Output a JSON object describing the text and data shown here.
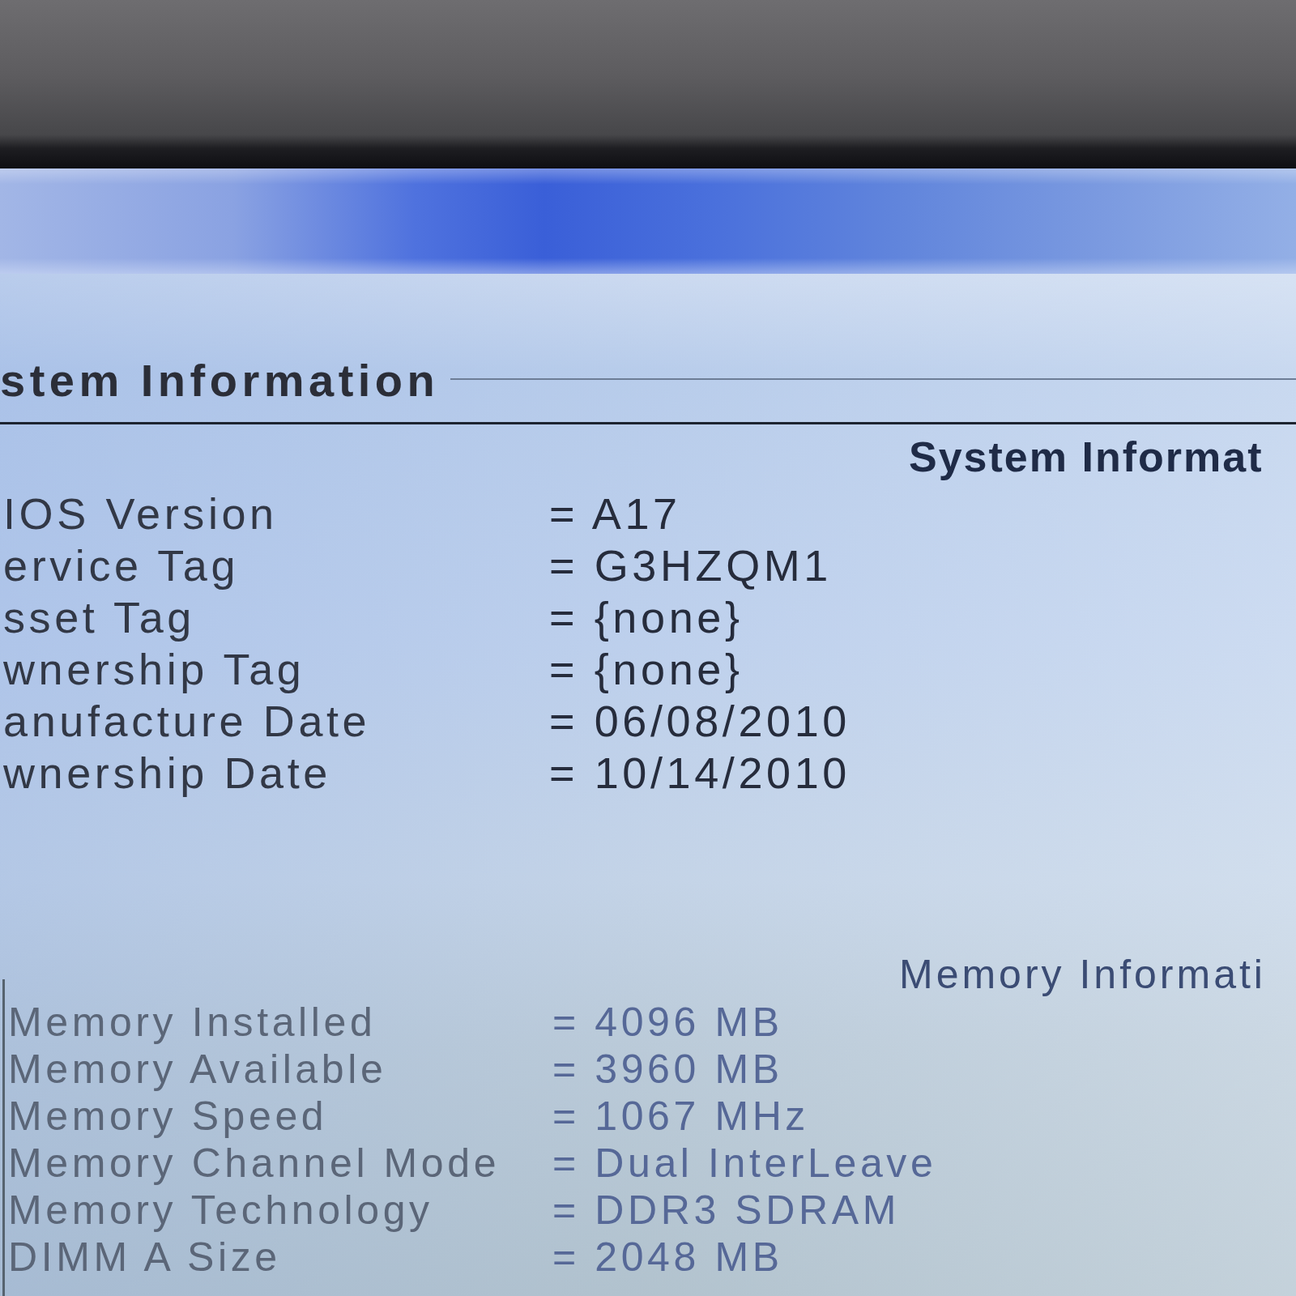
{
  "section": {
    "title": "stem Information"
  },
  "system_info": {
    "title": "System Informat",
    "rows": [
      {
        "label": "IOS Version",
        "value": "= A17"
      },
      {
        "label": "ervice Tag",
        "value": "= G3HZQM1"
      },
      {
        "label": "sset Tag",
        "value": "= {none}"
      },
      {
        "label": "wnership Tag",
        "value": "= {none}"
      },
      {
        "label": "anufacture Date",
        "value": "= 06/08/2010"
      },
      {
        "label": "wnership Date",
        "value": "= 10/14/2010"
      }
    ]
  },
  "memory_info": {
    "title": "Memory Informati",
    "rows": [
      {
        "label": "Memory Installed",
        "value": "= 4096 MB"
      },
      {
        "label": "Memory Available",
        "value": "= 3960 MB"
      },
      {
        "label": "Memory Speed",
        "value": "= 1067 MHz"
      },
      {
        "label": "Memory Channel Mode",
        "value": "= Dual InterLeave"
      },
      {
        "label": "Memory Technology",
        "value": "= DDR3 SDRAM"
      },
      {
        "label": "DIMM A Size",
        "value": "= 2048 MB"
      }
    ]
  }
}
